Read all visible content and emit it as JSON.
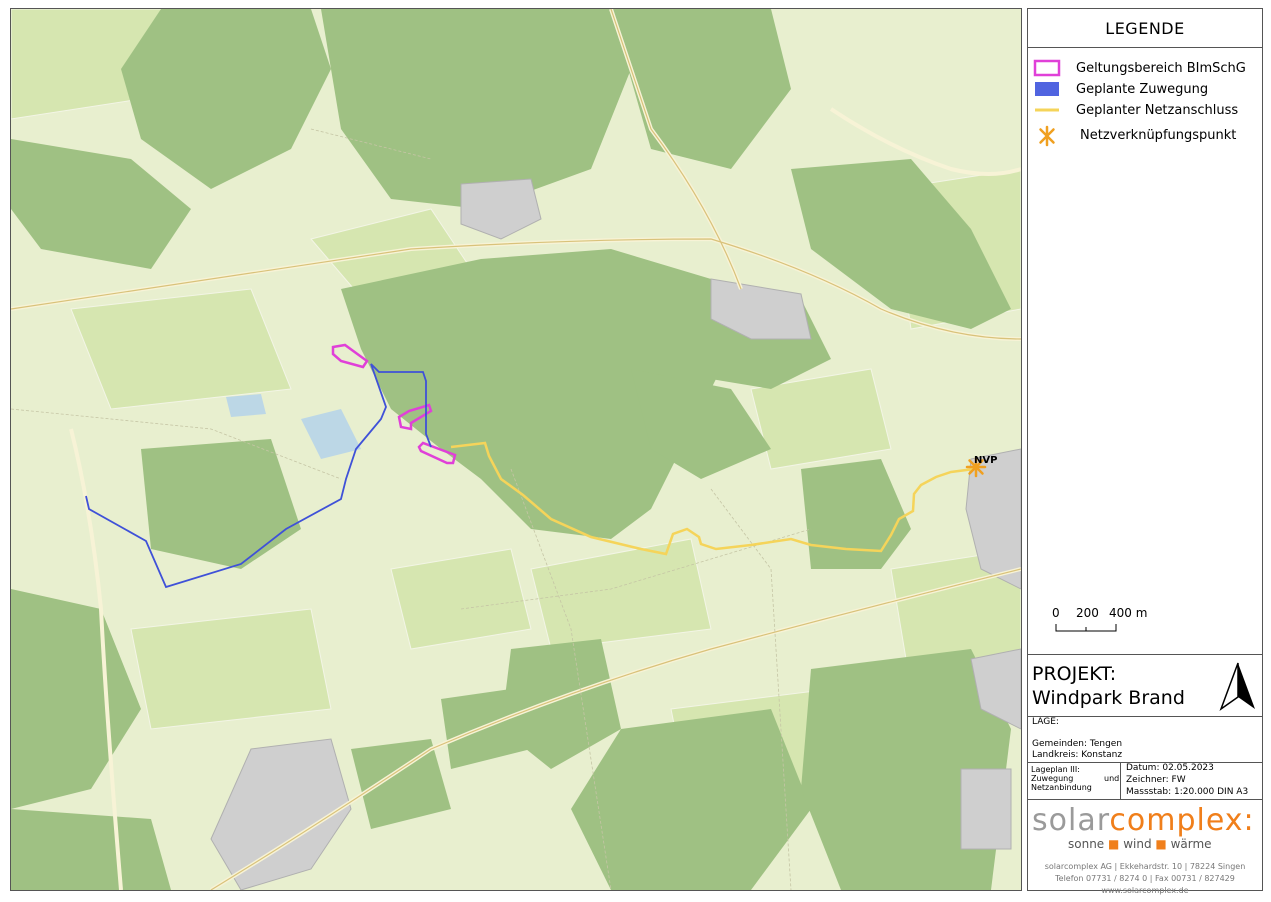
{
  "legend": {
    "title": "LEGENDE",
    "items": [
      {
        "label": "Geltungsbereich BImSchG",
        "color": "#e040d8"
      },
      {
        "label": "Geplante Zuwegung",
        "color": "#5064e0"
      },
      {
        "label": "Geplanter Netzanschluss",
        "color": "#f5d45a"
      },
      {
        "label": "Netzverknüpfungspunkt",
        "color": "#f0a020"
      }
    ]
  },
  "scale": {
    "labels": [
      "0",
      "200",
      "400 m"
    ]
  },
  "project": {
    "label": "PROJEKT:",
    "name": "Windpark Brand"
  },
  "lage": {
    "label": "LAGE:",
    "gemeinden": "Gemeinden: Tengen",
    "landkreis": "Landkreis: Konstanz"
  },
  "plan": {
    "line1": "Lageplan III:",
    "line2": "Zuwegung",
    "line2b": "und",
    "line3": "Netzanbindung"
  },
  "meta": {
    "datum": "Datum:      02.05.2023",
    "zeichner": "Zeichner:   FW",
    "massstab": "Massstab: 1:20.000   DIN A3"
  },
  "brand": {
    "name_a": "solar",
    "name_b": "complex:",
    "tag": [
      "sonne",
      "wind",
      "wärme"
    ],
    "addr1": "solarcomplex AG | Ekkehardstr. 10 | 78224 Singen",
    "addr2": "Telefon 07731 / 8274 0 | Fax 00731 / 827429",
    "addr3": "www.solarcomplex.de"
  },
  "map": {
    "nvp_label": "NVP"
  }
}
